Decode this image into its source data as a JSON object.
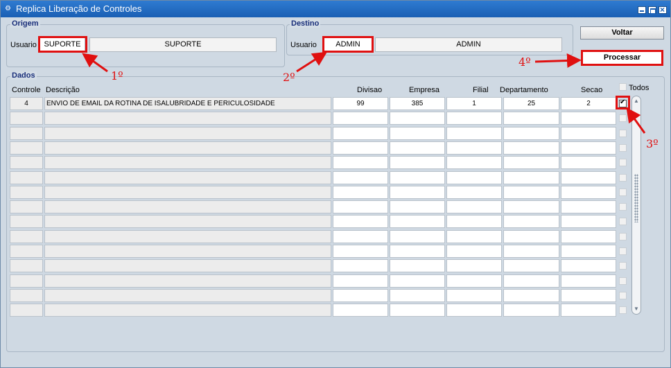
{
  "window": {
    "title": "Replica Liberação de Controles"
  },
  "origem": {
    "group_label": "Origem",
    "user_label": "Usuario",
    "user_code": "SUPORTE",
    "user_name": "SUPORTE"
  },
  "destino": {
    "group_label": "Destino",
    "user_label": "Usuario",
    "user_code": "ADMIN",
    "user_name": "ADMIN"
  },
  "buttons": {
    "voltar": "Voltar",
    "processar": "Processar"
  },
  "dados": {
    "group_label": "Dados",
    "headers": {
      "controle": "Controle",
      "descricao": "Descrição",
      "divisao": "Divisao",
      "empresa": "Empresa",
      "filial": "Filial",
      "departamento": "Departamento",
      "secao": "Secao",
      "todos": "Todos"
    },
    "todos_checked": false,
    "rows": [
      {
        "controle": "4",
        "descricao": "ENVIO DE EMAIL DA ROTINA DE ISALUBRIDADE E PERICULOSIDADE",
        "divisao": "99",
        "empresa": "385",
        "filial": "1",
        "departamento": "25",
        "secao": "2",
        "checked": true
      }
    ],
    "empty_rows": 14
  },
  "annotations": {
    "step1": "1º",
    "step2": "2º",
    "step3": "3º",
    "step4": "4º",
    "color": "#e01010"
  }
}
